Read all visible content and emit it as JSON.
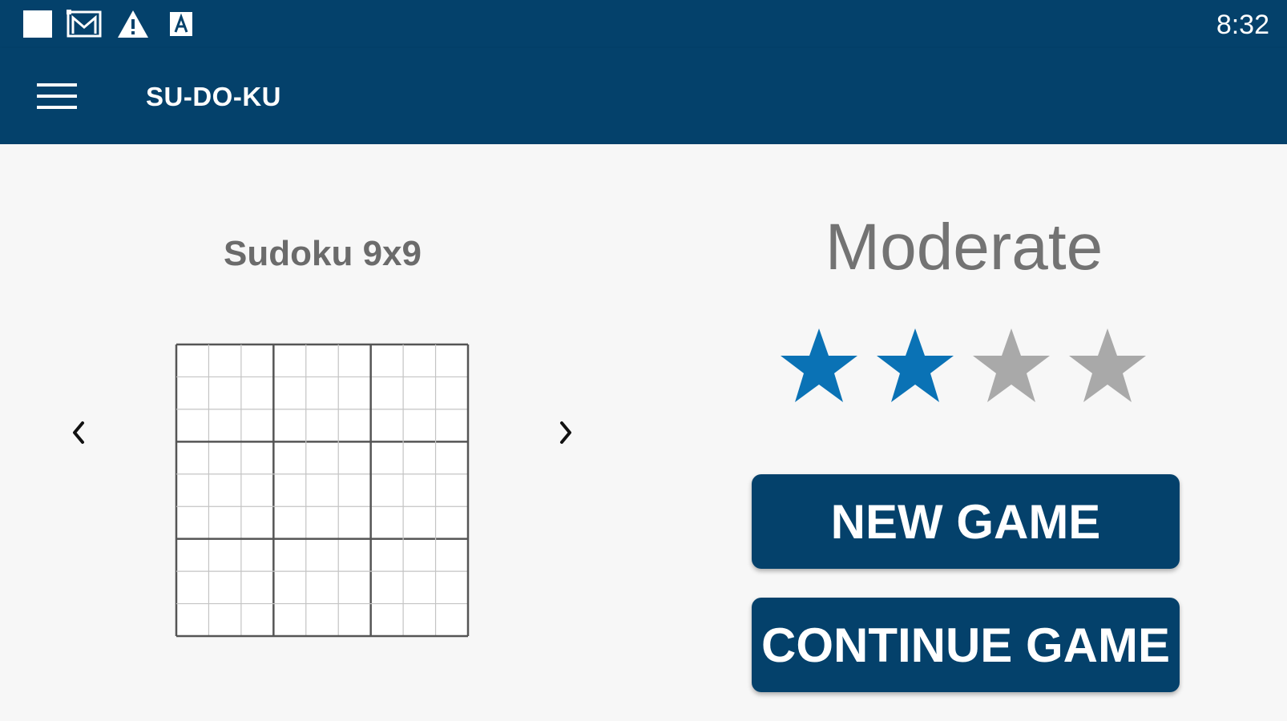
{
  "status_bar": {
    "icons": [
      "square-notification-icon",
      "gmail-icon",
      "warning-icon",
      "keyboard-icon"
    ],
    "time": "8:32"
  },
  "app_bar": {
    "menu_icon": "hamburger-menu-icon",
    "title": "SU-DO-KU"
  },
  "puzzle": {
    "title": "Sudoku 9x9",
    "grid_size": 9,
    "prev_icon": "chevron-left-icon",
    "next_icon": "chevron-right-icon"
  },
  "difficulty": {
    "label": "Moderate",
    "rating": 2,
    "max_rating": 4,
    "filled_color": "#0a72b5",
    "empty_color": "#a9a9a9"
  },
  "actions": {
    "new_game": "NEW GAME",
    "continue_game": "CONTINUE GAME"
  },
  "colors": {
    "primary": "#04416b",
    "background": "#f7f7f7",
    "text_gray": "#6b6b6b"
  }
}
